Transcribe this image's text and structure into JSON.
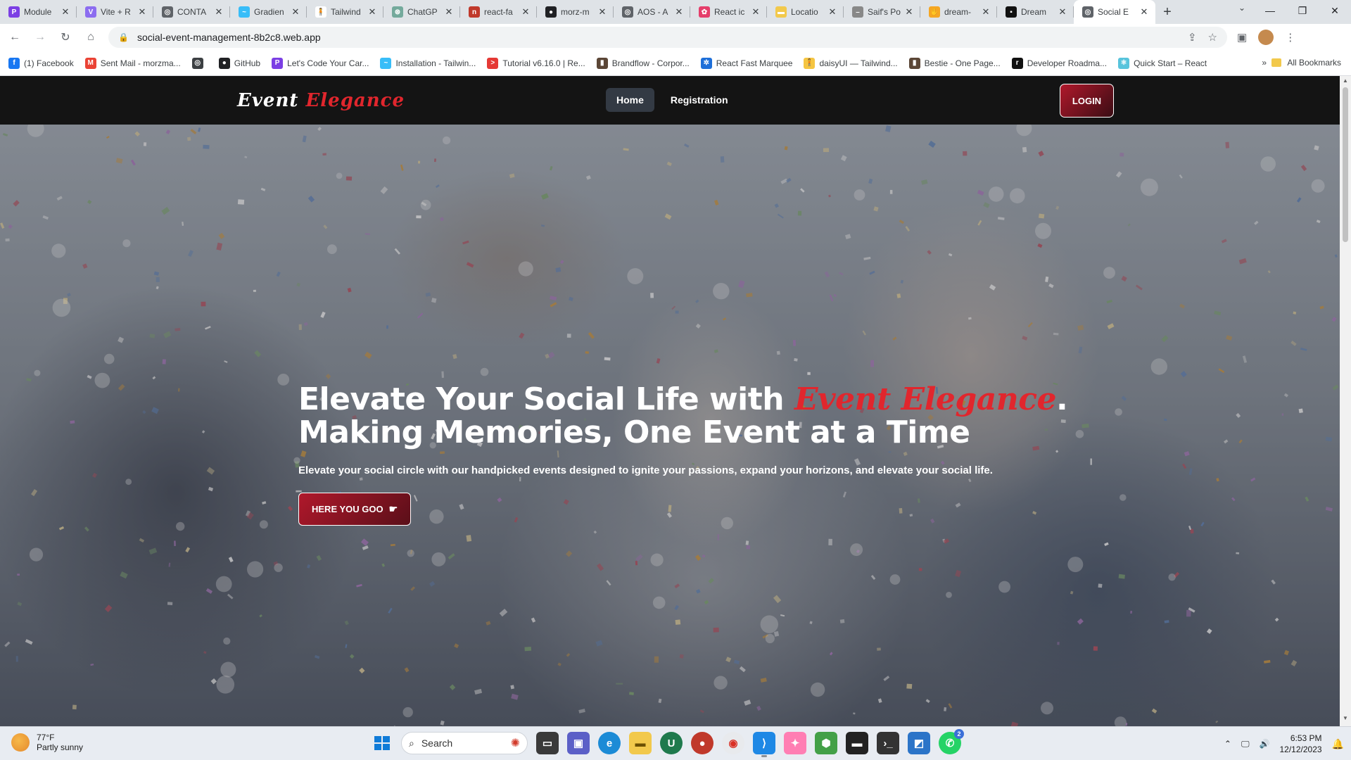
{
  "browser": {
    "tabs": [
      {
        "title": "Module",
        "favicon_color": "#7b3fe4",
        "favicon_glyph": "P"
      },
      {
        "title": "Vite + R",
        "favicon_color": "#8c6df0",
        "favicon_glyph": "V"
      },
      {
        "title": "CONTA",
        "favicon_color": "#5f6368",
        "favicon_glyph": "◎"
      },
      {
        "title": "Gradien",
        "favicon_color": "#38bdf8",
        "favicon_glyph": "~"
      },
      {
        "title": "Tailwind",
        "favicon_color": "#ffffff",
        "favicon_glyph": "🧍"
      },
      {
        "title": "ChatGP",
        "favicon_color": "#74aa9c",
        "favicon_glyph": "⊛"
      },
      {
        "title": "react-fa",
        "favicon_color": "#c0392b",
        "favicon_glyph": "n"
      },
      {
        "title": "morz-m",
        "favicon_color": "#202124",
        "favicon_glyph": "●"
      },
      {
        "title": "AOS - A",
        "favicon_color": "#5f6368",
        "favicon_glyph": "◎"
      },
      {
        "title": "React ic",
        "favicon_color": "#e53e6b",
        "favicon_glyph": "✿"
      },
      {
        "title": "Locatio",
        "favicon_color": "#f2c94c",
        "favicon_glyph": "▬"
      },
      {
        "title": "Saif's Po",
        "favicon_color": "#888888",
        "favicon_glyph": "–"
      },
      {
        "title": "dream-",
        "favicon_color": "#f5a623",
        "favicon_glyph": "✋"
      },
      {
        "title": "Dream",
        "favicon_color": "#111111",
        "favicon_glyph": "▪"
      },
      {
        "title": "Social E",
        "favicon_color": "#5f6368",
        "favicon_glyph": "◎",
        "active": true
      }
    ],
    "new_tab": "+",
    "window_controls": {
      "minimize": "—",
      "maximize": "❐",
      "close": "✕"
    },
    "address": "social-event-management-8b2c8.web.app",
    "bookmarks": [
      {
        "label": "(1) Facebook",
        "color": "#1877f2",
        "glyph": "f"
      },
      {
        "label": "Sent Mail - morzma...",
        "color": "#ea4335",
        "glyph": "M"
      },
      {
        "label": "",
        "color": "#3c4043",
        "glyph": "◎"
      },
      {
        "label": "GitHub",
        "color": "#202124",
        "glyph": "●"
      },
      {
        "label": "Let's Code Your Car...",
        "color": "#7b3fe4",
        "glyph": "P"
      },
      {
        "label": "Installation - Tailwin...",
        "color": "#38bdf8",
        "glyph": "~"
      },
      {
        "label": "Tutorial v6.16.0 | Re...",
        "color": "#e53935",
        "glyph": ">"
      },
      {
        "label": "Brandflow - Corpor...",
        "color": "#5b4636",
        "glyph": "▮"
      },
      {
        "label": "React Fast Marquee",
        "color": "#1e6fd9",
        "glyph": "✲"
      },
      {
        "label": "daisyUI — Tailwind...",
        "color": "#f5c542",
        "glyph": "🧍"
      },
      {
        "label": "Bestie - One Page...",
        "color": "#5b4636",
        "glyph": "▮"
      },
      {
        "label": "Developer Roadma...",
        "color": "#111111",
        "glyph": "r"
      },
      {
        "label": "Quick Start – React",
        "color": "#58c4dc",
        "glyph": "⚛"
      }
    ],
    "bookmarks_more": "»",
    "all_bookmarks": "All Bookmarks"
  },
  "site": {
    "logo_main": "Event",
    "logo_accent": "Elegance",
    "nav": [
      {
        "label": "Home",
        "active": true
      },
      {
        "label": "Registration",
        "active": false
      }
    ],
    "login_label": "LOGIN",
    "hero": {
      "title_line1_prefix": "Elevate Your Social Life with ",
      "title_brand": "Event Elegance",
      "title_line1_suffix": ".",
      "title_line2": "Making Memories, One Event at a Time",
      "subtitle": "Elevate your social circle with our handpicked events designed to ignite your passions, expand your horizons, and elevate your social life.",
      "cta_label": "HERE YOU GOO",
      "cta_icon": "hand-pointing-right-icon"
    },
    "colors": {
      "accent": "#e1262d",
      "nav_bg": "#141414",
      "active_nav": "#333a44"
    }
  },
  "taskbar": {
    "weather_temp": "77°F",
    "weather_desc": "Partly sunny",
    "search_placeholder": "Search",
    "time": "6:53 PM",
    "date": "12/12/2023",
    "whatsapp_badge": "2"
  }
}
